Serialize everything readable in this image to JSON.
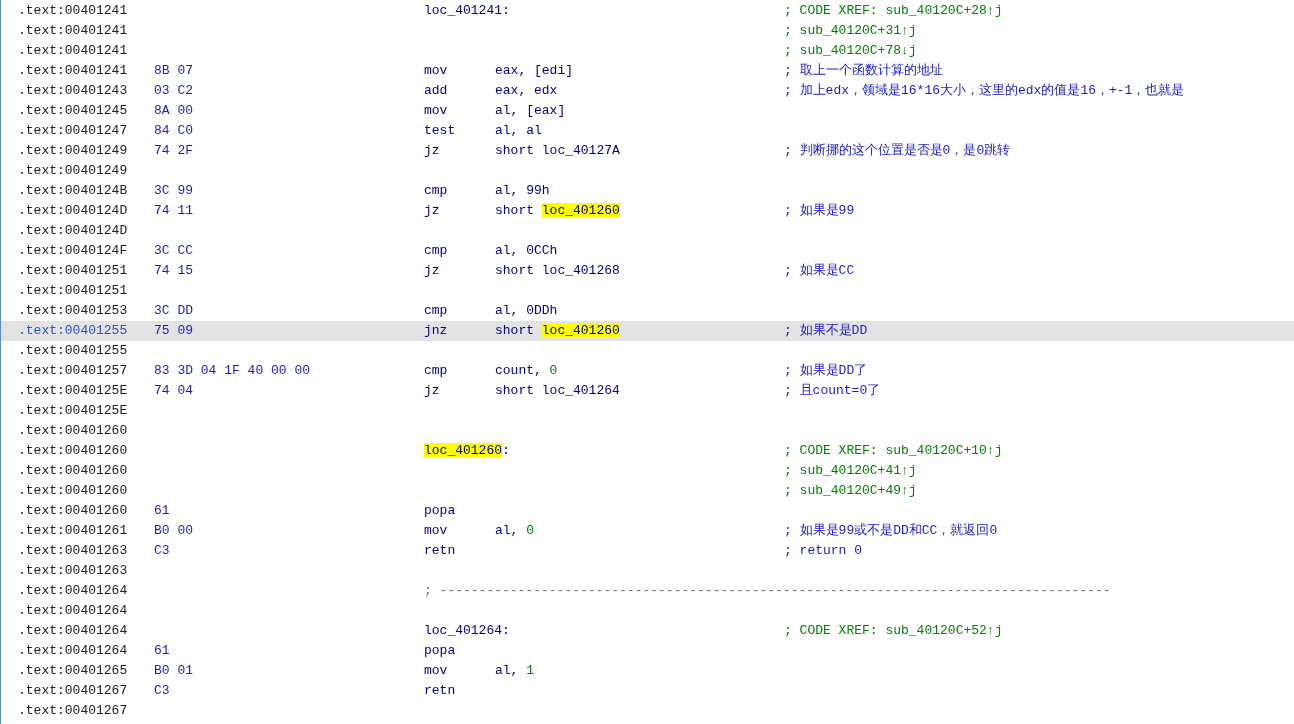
{
  "listing": {
    "rows": [
      {
        "address": ".text:00401241",
        "selected": false,
        "label": [
          {
            "text": "loc_401241:",
            "kind": "plain"
          }
        ],
        "comment": {
          "text": "; CODE XREF: sub_40120C+28↑j",
          "kind": "xref"
        }
      },
      {
        "address": ".text:00401241",
        "selected": false,
        "comment": {
          "text": "; sub_40120C+31↑j",
          "kind": "xref"
        }
      },
      {
        "address": ".text:00401241",
        "selected": false,
        "comment": {
          "text": "; sub_40120C+78↓j",
          "kind": "xref"
        }
      },
      {
        "address": ".text:00401241",
        "selected": false,
        "bytes": "8B 07",
        "mnemonic": "mov",
        "operand": [
          {
            "text": "eax, [edi]",
            "kind": "plain"
          }
        ],
        "comment": {
          "text": "; 取上一个函数计算的地址",
          "kind": "note"
        }
      },
      {
        "address": ".text:00401243",
        "selected": false,
        "bytes": "03 C2",
        "mnemonic": "add",
        "operand": [
          {
            "text": "eax, edx",
            "kind": "plain"
          }
        ],
        "comment": {
          "text": "; 加上edx，领域是16*16大小，这里的edx的值是16，+-1，也就是",
          "kind": "note"
        }
      },
      {
        "address": ".text:00401245",
        "selected": false,
        "bytes": "8A 00",
        "mnemonic": "mov",
        "operand": [
          {
            "text": "al, [eax]",
            "kind": "plain"
          }
        ]
      },
      {
        "address": ".text:00401247",
        "selected": false,
        "bytes": "84 C0",
        "mnemonic": "test",
        "operand": [
          {
            "text": "al, al",
            "kind": "plain"
          }
        ]
      },
      {
        "address": ".text:00401249",
        "selected": false,
        "bytes": "74 2F",
        "mnemonic": "jz",
        "operand": [
          {
            "text": "short loc_40127A",
            "kind": "plain"
          }
        ],
        "comment": {
          "text": "; 判断挪的这个位置是否是0，是0跳转",
          "kind": "note"
        }
      },
      {
        "address": ".text:00401249",
        "selected": false
      },
      {
        "address": ".text:0040124B",
        "selected": false,
        "bytes": "3C 99",
        "mnemonic": "cmp",
        "operand": [
          {
            "text": "al, 99h",
            "kind": "plain"
          }
        ]
      },
      {
        "address": ".text:0040124D",
        "selected": false,
        "bytes": "74 11",
        "mnemonic": "jz",
        "operand": [
          {
            "text": "short ",
            "kind": "plain"
          },
          {
            "text": "loc_401260",
            "kind": "highlight"
          }
        ],
        "comment": {
          "text": "; 如果是99",
          "kind": "note"
        }
      },
      {
        "address": ".text:0040124D",
        "selected": false
      },
      {
        "address": ".text:0040124F",
        "selected": false,
        "bytes": "3C CC",
        "mnemonic": "cmp",
        "operand": [
          {
            "text": "al, 0CCh",
            "kind": "plain"
          }
        ]
      },
      {
        "address": ".text:00401251",
        "selected": false,
        "bytes": "74 15",
        "mnemonic": "jz",
        "operand": [
          {
            "text": "short loc_401268",
            "kind": "plain"
          }
        ],
        "comment": {
          "text": "; 如果是CC",
          "kind": "note"
        }
      },
      {
        "address": ".text:00401251",
        "selected": false
      },
      {
        "address": ".text:00401253",
        "selected": false,
        "bytes": "3C DD",
        "mnemonic": "cmp",
        "operand": [
          {
            "text": "al, 0DDh",
            "kind": "plain"
          }
        ]
      },
      {
        "address": ".text:00401255",
        "selected": true,
        "bytes": "75 09",
        "mnemonic": "jnz",
        "operand": [
          {
            "text": "short ",
            "kind": "plain"
          },
          {
            "text": "loc_401260",
            "kind": "highlight"
          }
        ],
        "comment": {
          "text": "; 如果不是DD",
          "kind": "note"
        }
      },
      {
        "address": ".text:00401255",
        "selected": false
      },
      {
        "address": ".text:00401257",
        "selected": false,
        "bytes": "83 3D 04 1F 40 00 00",
        "mnemonic": "cmp",
        "operand": [
          {
            "text": "count, ",
            "kind": "plain"
          },
          {
            "text": "0",
            "kind": "number"
          }
        ],
        "comment": {
          "text": "; 如果是DD了",
          "kind": "note"
        }
      },
      {
        "address": ".text:0040125E",
        "selected": false,
        "bytes": "74 04",
        "mnemonic": "jz",
        "operand": [
          {
            "text": "short loc_401264",
            "kind": "plain"
          }
        ],
        "comment": {
          "text": "; 且count=0了",
          "kind": "note"
        }
      },
      {
        "address": ".text:0040125E",
        "selected": false
      },
      {
        "address": ".text:00401260",
        "selected": false
      },
      {
        "address": ".text:00401260",
        "selected": false,
        "label": [
          {
            "text": "loc_401260",
            "kind": "highlight"
          },
          {
            "text": ":",
            "kind": "plain"
          }
        ],
        "comment": {
          "text": "; CODE XREF: sub_40120C+10↑j",
          "kind": "xref"
        }
      },
      {
        "address": ".text:00401260",
        "selected": false,
        "comment": {
          "text": "; sub_40120C+41↑j",
          "kind": "xref"
        }
      },
      {
        "address": ".text:00401260",
        "selected": false,
        "comment": {
          "text": "; sub_40120C+49↑j",
          "kind": "xref"
        }
      },
      {
        "address": ".text:00401260",
        "selected": false,
        "bytes": "61",
        "mnemonic": "popa"
      },
      {
        "address": ".text:00401261",
        "selected": false,
        "bytes": "B0 00",
        "mnemonic": "mov",
        "operand": [
          {
            "text": "al, ",
            "kind": "plain"
          },
          {
            "text": "0",
            "kind": "number"
          }
        ],
        "comment": {
          "text": "; 如果是99或不是DD和CC，就返回0",
          "kind": "note"
        }
      },
      {
        "address": ".text:00401263",
        "selected": false,
        "bytes": "C3",
        "mnemonic": "retn",
        "comment": {
          "text": "; return 0",
          "kind": "note"
        }
      },
      {
        "address": ".text:00401263",
        "selected": false
      },
      {
        "address": ".text:00401264",
        "selected": false,
        "separator": "; --------------------------------------------------------------------------------------"
      },
      {
        "address": ".text:00401264",
        "selected": false
      },
      {
        "address": ".text:00401264",
        "selected": false,
        "label": [
          {
            "text": "loc_401264:",
            "kind": "plain"
          }
        ],
        "comment": {
          "text": "; CODE XREF: sub_40120C+52↑j",
          "kind": "xref"
        }
      },
      {
        "address": ".text:00401264",
        "selected": false,
        "bytes": "61",
        "mnemonic": "popa"
      },
      {
        "address": ".text:00401265",
        "selected": false,
        "bytes": "B0 01",
        "mnemonic": "mov",
        "operand": [
          {
            "text": "al, ",
            "kind": "plain"
          },
          {
            "text": "1",
            "kind": "number"
          }
        ]
      },
      {
        "address": ".text:00401267",
        "selected": false,
        "bytes": "C3",
        "mnemonic": "retn"
      },
      {
        "address": ".text:00401267",
        "selected": false
      }
    ]
  }
}
